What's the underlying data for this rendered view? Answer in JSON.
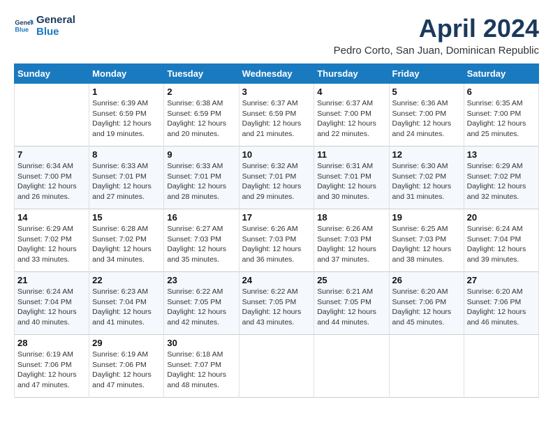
{
  "header": {
    "logo_line1": "General",
    "logo_line2": "Blue",
    "month_title": "April 2024",
    "location": "Pedro Corto, San Juan, Dominican Republic"
  },
  "days_of_week": [
    "Sunday",
    "Monday",
    "Tuesday",
    "Wednesday",
    "Thursday",
    "Friday",
    "Saturday"
  ],
  "weeks": [
    [
      {
        "num": "",
        "info": ""
      },
      {
        "num": "1",
        "info": "Sunrise: 6:39 AM\nSunset: 6:59 PM\nDaylight: 12 hours\nand 19 minutes."
      },
      {
        "num": "2",
        "info": "Sunrise: 6:38 AM\nSunset: 6:59 PM\nDaylight: 12 hours\nand 20 minutes."
      },
      {
        "num": "3",
        "info": "Sunrise: 6:37 AM\nSunset: 6:59 PM\nDaylight: 12 hours\nand 21 minutes."
      },
      {
        "num": "4",
        "info": "Sunrise: 6:37 AM\nSunset: 7:00 PM\nDaylight: 12 hours\nand 22 minutes."
      },
      {
        "num": "5",
        "info": "Sunrise: 6:36 AM\nSunset: 7:00 PM\nDaylight: 12 hours\nand 24 minutes."
      },
      {
        "num": "6",
        "info": "Sunrise: 6:35 AM\nSunset: 7:00 PM\nDaylight: 12 hours\nand 25 minutes."
      }
    ],
    [
      {
        "num": "7",
        "info": "Sunrise: 6:34 AM\nSunset: 7:00 PM\nDaylight: 12 hours\nand 26 minutes."
      },
      {
        "num": "8",
        "info": "Sunrise: 6:33 AM\nSunset: 7:01 PM\nDaylight: 12 hours\nand 27 minutes."
      },
      {
        "num": "9",
        "info": "Sunrise: 6:33 AM\nSunset: 7:01 PM\nDaylight: 12 hours\nand 28 minutes."
      },
      {
        "num": "10",
        "info": "Sunrise: 6:32 AM\nSunset: 7:01 PM\nDaylight: 12 hours\nand 29 minutes."
      },
      {
        "num": "11",
        "info": "Sunrise: 6:31 AM\nSunset: 7:01 PM\nDaylight: 12 hours\nand 30 minutes."
      },
      {
        "num": "12",
        "info": "Sunrise: 6:30 AM\nSunset: 7:02 PM\nDaylight: 12 hours\nand 31 minutes."
      },
      {
        "num": "13",
        "info": "Sunrise: 6:29 AM\nSunset: 7:02 PM\nDaylight: 12 hours\nand 32 minutes."
      }
    ],
    [
      {
        "num": "14",
        "info": "Sunrise: 6:29 AM\nSunset: 7:02 PM\nDaylight: 12 hours\nand 33 minutes."
      },
      {
        "num": "15",
        "info": "Sunrise: 6:28 AM\nSunset: 7:02 PM\nDaylight: 12 hours\nand 34 minutes."
      },
      {
        "num": "16",
        "info": "Sunrise: 6:27 AM\nSunset: 7:03 PM\nDaylight: 12 hours\nand 35 minutes."
      },
      {
        "num": "17",
        "info": "Sunrise: 6:26 AM\nSunset: 7:03 PM\nDaylight: 12 hours\nand 36 minutes."
      },
      {
        "num": "18",
        "info": "Sunrise: 6:26 AM\nSunset: 7:03 PM\nDaylight: 12 hours\nand 37 minutes."
      },
      {
        "num": "19",
        "info": "Sunrise: 6:25 AM\nSunset: 7:03 PM\nDaylight: 12 hours\nand 38 minutes."
      },
      {
        "num": "20",
        "info": "Sunrise: 6:24 AM\nSunset: 7:04 PM\nDaylight: 12 hours\nand 39 minutes."
      }
    ],
    [
      {
        "num": "21",
        "info": "Sunrise: 6:24 AM\nSunset: 7:04 PM\nDaylight: 12 hours\nand 40 minutes."
      },
      {
        "num": "22",
        "info": "Sunrise: 6:23 AM\nSunset: 7:04 PM\nDaylight: 12 hours\nand 41 minutes."
      },
      {
        "num": "23",
        "info": "Sunrise: 6:22 AM\nSunset: 7:05 PM\nDaylight: 12 hours\nand 42 minutes."
      },
      {
        "num": "24",
        "info": "Sunrise: 6:22 AM\nSunset: 7:05 PM\nDaylight: 12 hours\nand 43 minutes."
      },
      {
        "num": "25",
        "info": "Sunrise: 6:21 AM\nSunset: 7:05 PM\nDaylight: 12 hours\nand 44 minutes."
      },
      {
        "num": "26",
        "info": "Sunrise: 6:20 AM\nSunset: 7:06 PM\nDaylight: 12 hours\nand 45 minutes."
      },
      {
        "num": "27",
        "info": "Sunrise: 6:20 AM\nSunset: 7:06 PM\nDaylight: 12 hours\nand 46 minutes."
      }
    ],
    [
      {
        "num": "28",
        "info": "Sunrise: 6:19 AM\nSunset: 7:06 PM\nDaylight: 12 hours\nand 47 minutes."
      },
      {
        "num": "29",
        "info": "Sunrise: 6:19 AM\nSunset: 7:06 PM\nDaylight: 12 hours\nand 47 minutes."
      },
      {
        "num": "30",
        "info": "Sunrise: 6:18 AM\nSunset: 7:07 PM\nDaylight: 12 hours\nand 48 minutes."
      },
      {
        "num": "",
        "info": ""
      },
      {
        "num": "",
        "info": ""
      },
      {
        "num": "",
        "info": ""
      },
      {
        "num": "",
        "info": ""
      }
    ]
  ]
}
